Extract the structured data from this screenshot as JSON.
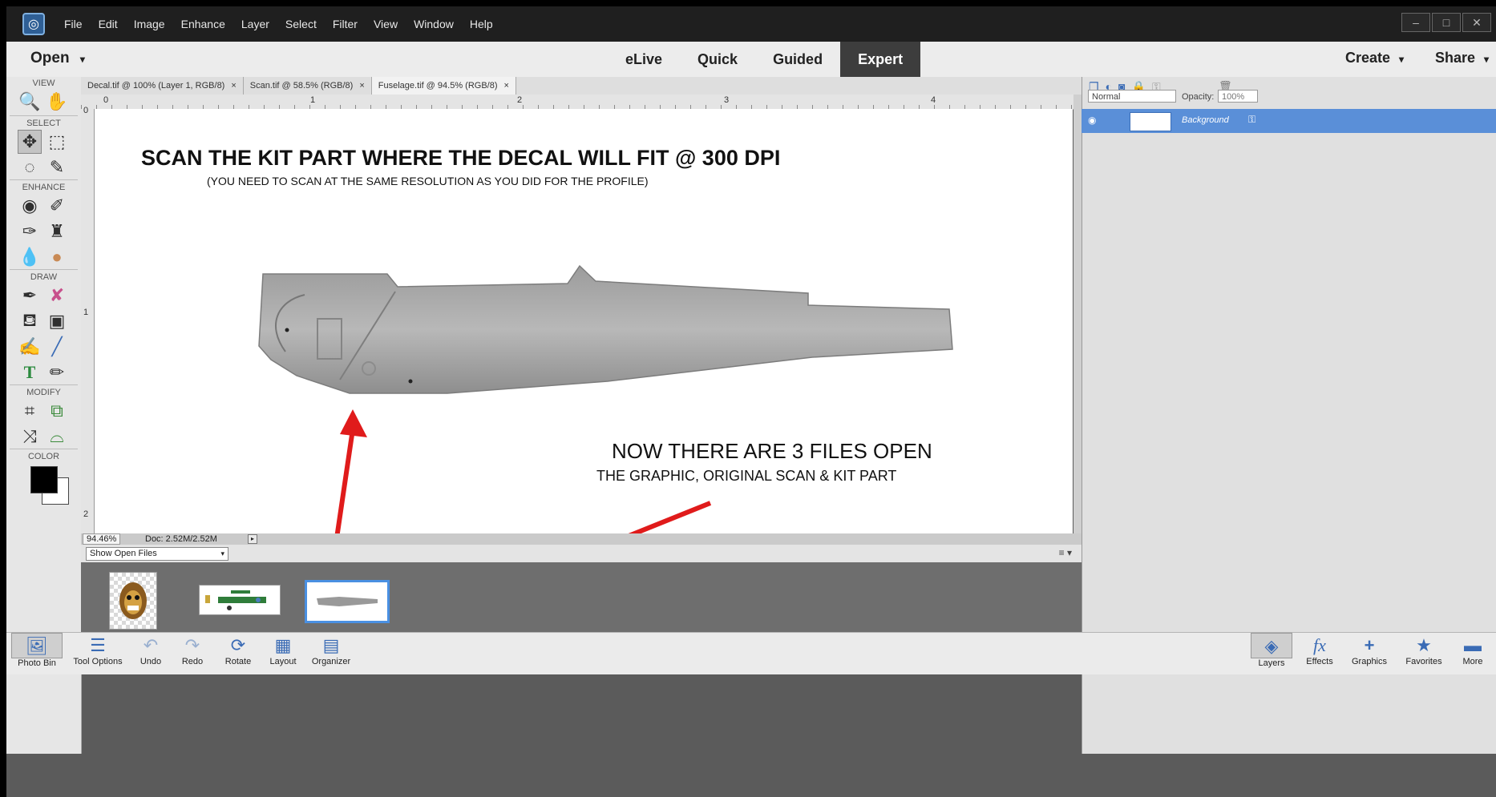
{
  "menu": {
    "items": [
      "File",
      "Edit",
      "Image",
      "Enhance",
      "Layer",
      "Select",
      "Filter",
      "View",
      "Window",
      "Help"
    ]
  },
  "window_controls": [
    "–",
    "□",
    "✕"
  ],
  "mode_bar": {
    "open_label": "Open",
    "open_caret": "▾",
    "tabs": [
      "eLive",
      "Quick",
      "Guided",
      "Expert"
    ],
    "active_tab": "Expert",
    "create_label": "Create",
    "share_label": "Share",
    "caret": "▾"
  },
  "toolbar": {
    "sections": [
      "VIEW",
      "SELECT",
      "ENHANCE",
      "DRAW",
      "MODIFY",
      "COLOR"
    ],
    "tools": [
      {
        "icon": "zoom-icon",
        "glyph": "🔍"
      },
      {
        "icon": "hand-icon",
        "glyph": "✋"
      },
      {
        "icon": "move-icon",
        "glyph": "✥"
      },
      {
        "icon": "marquee-icon",
        "glyph": "⬚"
      },
      {
        "icon": "lasso-icon",
        "glyph": "◌"
      },
      {
        "icon": "quick-selection-icon",
        "glyph": "✎"
      },
      {
        "icon": "red-eye-icon",
        "glyph": "◉"
      },
      {
        "icon": "spot-healing-icon",
        "glyph": "✐"
      },
      {
        "icon": "smart-brush-icon",
        "glyph": "✑"
      },
      {
        "icon": "clone-stamp-icon",
        "glyph": "♜"
      },
      {
        "icon": "blur-icon",
        "glyph": "💧"
      },
      {
        "icon": "sponge-icon",
        "glyph": "●"
      },
      {
        "icon": "brush-icon",
        "glyph": "✒"
      },
      {
        "icon": "eraser-icon",
        "glyph": "✘"
      },
      {
        "icon": "paint-bucket-icon",
        "glyph": "⛾"
      },
      {
        "icon": "gradient-icon",
        "glyph": "▣"
      },
      {
        "icon": "eyedropper-icon",
        "glyph": "✍"
      },
      {
        "icon": "pencil-line-icon",
        "glyph": "╱"
      },
      {
        "icon": "type-icon",
        "glyph": "T"
      },
      {
        "icon": "pencil-icon",
        "glyph": "✏"
      },
      {
        "icon": "crop-icon",
        "glyph": "⌗"
      },
      {
        "icon": "recompose-icon",
        "glyph": "⧉"
      },
      {
        "icon": "content-aware-move-icon",
        "glyph": "⤨"
      },
      {
        "icon": "straighten-icon",
        "glyph": "⌓"
      }
    ]
  },
  "document_tabs": [
    {
      "label": "Decal.tif @ 100% (Layer 1, RGB/8)",
      "close": "×"
    },
    {
      "label": "Scan.tif @ 58.5% (RGB/8)",
      "close": "×"
    },
    {
      "label": "Fuselage.tif @ 94.5% (RGB/8)",
      "close": "×"
    }
  ],
  "ruler": {
    "top": [
      "0",
      "1",
      "2",
      "3",
      "4"
    ],
    "left": [
      "0",
      "1",
      "2"
    ]
  },
  "canvas": {
    "headline": "SCAN THE KIT PART WHERE THE DECAL WILL FIT @ 300 DPI",
    "subline": "(YOU NEED TO SCAN AT THE SAME RESOLUTION AS YOU DID FOR THE PROFILE)",
    "note_title": "NOW THERE ARE 3 FILES OPEN",
    "note_body": "THE GRAPHIC, ORIGINAL SCAN & KIT PART",
    "arrow_color": "#e01b1b"
  },
  "status": {
    "zoom": "94.46%",
    "doc": "Doc: 2.52M/2.52M",
    "arrow": "▸"
  },
  "photo_bin": {
    "select_value": "Show Open Files",
    "select_arrow": "▾",
    "options_icon": "≡ ▾"
  },
  "layers_panel": {
    "blend_mode": "Normal",
    "opacity_label": "Opacity:",
    "opacity_value": "100%",
    "layer_name": "Background",
    "trash": "🗑",
    "icons": [
      "new-layer-icon",
      "adjustment-icon",
      "mask-icon",
      "lock-icon",
      "lock-all-icon"
    ]
  },
  "taskbar": {
    "left": [
      {
        "label": "Photo Bin",
        "icon": "photo-bin-icon",
        "glyph": "🖼"
      },
      {
        "label": "Tool Options",
        "icon": "tool-options-icon",
        "glyph": "☰"
      },
      {
        "label": "Undo",
        "icon": "undo-icon",
        "glyph": "↶"
      },
      {
        "label": "Redo",
        "icon": "redo-icon",
        "glyph": "↷"
      },
      {
        "label": "Rotate",
        "icon": "rotate-icon",
        "glyph": "⟳"
      },
      {
        "label": "Layout",
        "icon": "layout-icon",
        "glyph": "▦"
      },
      {
        "label": "Organizer",
        "icon": "organizer-icon",
        "glyph": "▤"
      }
    ],
    "right": [
      {
        "label": "Layers",
        "icon": "layers-icon",
        "glyph": "◈"
      },
      {
        "label": "Effects",
        "icon": "effects-icon",
        "glyph": "fx"
      },
      {
        "label": "Graphics",
        "icon": "graphics-icon",
        "glyph": "+"
      },
      {
        "label": "Favorites",
        "icon": "favorites-icon",
        "glyph": "★"
      },
      {
        "label": "More",
        "icon": "more-icon",
        "glyph": "▬"
      }
    ]
  }
}
